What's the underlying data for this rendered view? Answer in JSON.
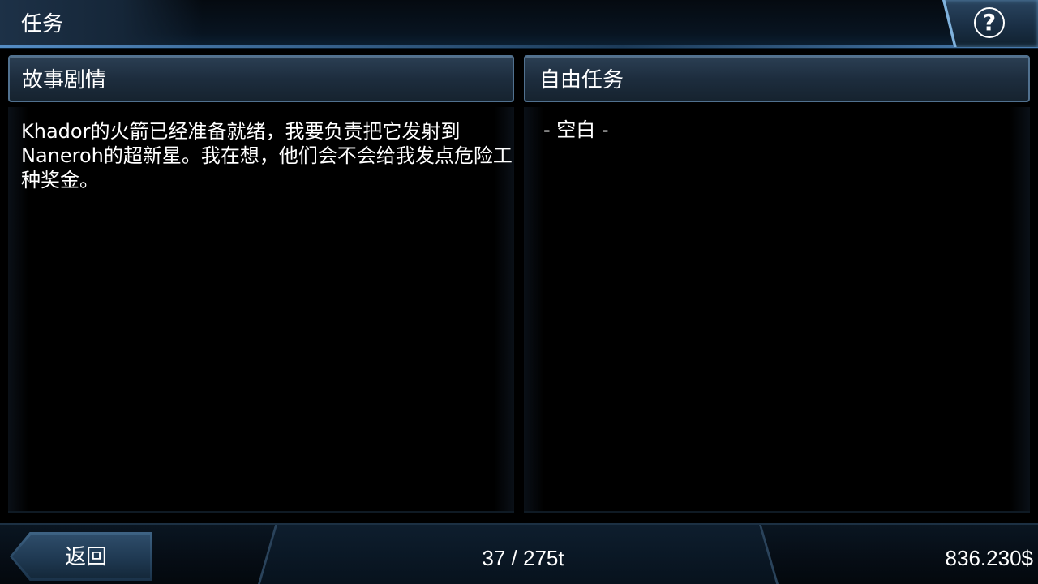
{
  "header": {
    "title": "任务",
    "help_label": "?"
  },
  "story_panel": {
    "header": "故事剧情",
    "text": "Khador的火箭已经准备就绪，我要负责把它发射到Naneroh的超新星。我在想，他们会不会给我发点危险工种奖金。"
  },
  "free_panel": {
    "header": "自由任务",
    "empty_text": "- 空白 -"
  },
  "footer": {
    "back_label": "返回",
    "cargo": "37 / 275t",
    "money": "836.230$"
  },
  "colors": {
    "background": "#000000",
    "panel_border": "#51718f",
    "accent_blue": "#7fb2dd",
    "text": "#ffffff"
  },
  "icons": {
    "help": "question-circle-icon",
    "back": "left-arrow-button-shape"
  }
}
